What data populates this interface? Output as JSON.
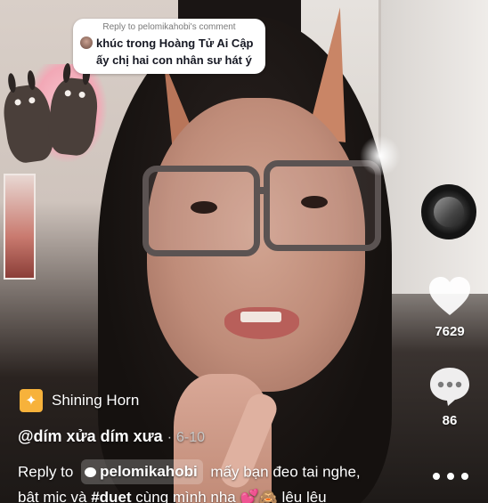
{
  "reply_bubble": {
    "header": "Reply to pelomikahobi's comment",
    "comment_text": "khúc trong Hoàng Tử Ai Cập ấy chị hai con nhân sư hát ý"
  },
  "right_rail": {
    "like_count": "7629",
    "comment_count": "86"
  },
  "effect": {
    "icon": "shining-star-icon",
    "name": "Shining Horn"
  },
  "post": {
    "username": "@dím xửa dím xưa",
    "separator": "·",
    "date": "6-10",
    "caption_prefix": "Reply to",
    "mention": "pelomikahobi",
    "caption_line1_rest": "mấy bạn đeo tai nghe,",
    "caption_line2": "bật mic và",
    "hashtag": "#duet",
    "caption_line2_rest": "cùng mình nha 💕🙈 lêu lêu"
  },
  "colors": {
    "effect_icon_bg": "#f7b23b",
    "overlay_text": "#ffffff",
    "reply_text": "#161823"
  }
}
